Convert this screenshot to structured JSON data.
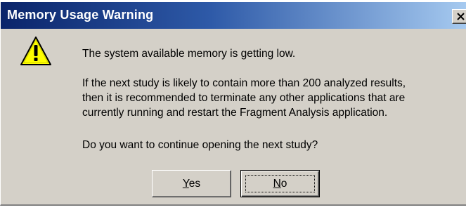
{
  "dialog": {
    "title": "Memory Usage Warning",
    "close_label": "×",
    "icon": "warning-icon",
    "message_line1": "The system available memory is getting low.",
    "message_line2": "If the next study is likely to contain more than 200 analyzed results,",
    "message_line3": "then it is recommended to terminate any other applications that are",
    "message_line4": "currently running and restart the Fragment Analysis application.",
    "message_line5": "Do you want to continue opening the next study?",
    "buttons": {
      "yes_mnemonic": "Y",
      "yes_rest": "es",
      "no_mnemonic": "N",
      "no_rest": "o"
    },
    "colors": {
      "titlebar_start": "#0a246a",
      "titlebar_end": "#a6caf0",
      "face": "#d4d0c8",
      "warning_yellow": "#ffff00"
    }
  }
}
